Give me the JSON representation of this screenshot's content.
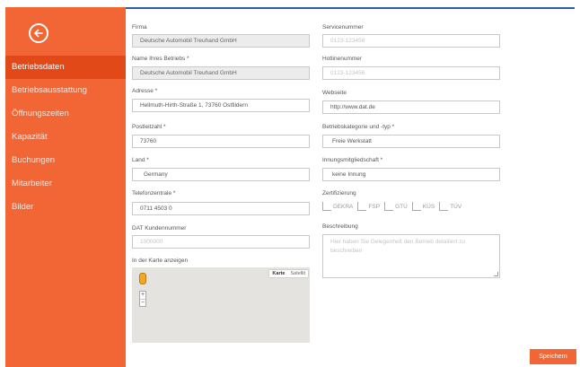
{
  "sidebar": {
    "items": [
      {
        "label": "Betriebsdaten"
      },
      {
        "label": "Betriebsausstattung"
      },
      {
        "label": "Öffnungszeiten"
      },
      {
        "label": "Kapazität"
      },
      {
        "label": "Buchungen"
      },
      {
        "label": "Mitarbeiter"
      },
      {
        "label": "Bilder"
      }
    ],
    "accent_color": "#f26534",
    "active_color": "#e14a18"
  },
  "form": {
    "firma": {
      "label": "Firma",
      "value": "Deutsche Automobil Treuhand GmbH"
    },
    "name_betrieb": {
      "label": "Name Ihres Betriebs *",
      "value": "Deutsche Automobil Treuhand GmbH"
    },
    "adresse": {
      "label": "Adresse *",
      "value": "Hellmuth-Hirth-Straße 1, 73760 Ostfildern"
    },
    "postleitzahl": {
      "label": "Postleitzahl *",
      "value": "73760"
    },
    "land": {
      "label": "Land *",
      "value": "Germany"
    },
    "telefonzentrale": {
      "label": "Telefonzentrale *",
      "value": "0711 4503 0"
    },
    "dat_kundennummer": {
      "label": "DAT Kundennummer",
      "value": "1000000"
    },
    "karte": {
      "label": "In der Karte anzeigen",
      "map_type": "Karte",
      "satellite": "Satellit",
      "zoom_in": "+",
      "zoom_out": "−"
    },
    "servicenummer": {
      "label": "Servicenummer",
      "placeholder": "0123-123456"
    },
    "hotlinenummer": {
      "label": "Hotlinenummer",
      "placeholder": "0123-123456"
    },
    "webseite": {
      "label": "Webseite",
      "value": "http://www.dat.de"
    },
    "betriebskategorie": {
      "label": "Betriebskategorie und -typ *",
      "value": "Freie Werkstatt"
    },
    "innung": {
      "label": "Innungsmitgliedschaft *",
      "value": "keine Innung"
    },
    "zertifizierung": {
      "label": "Zertifizierung",
      "options": [
        "DEKRA",
        "FSP",
        "GTÜ",
        "KÜS",
        "TÜV"
      ]
    },
    "beschreibung": {
      "label": "Beschreibung",
      "placeholder": "Hier haben Sie Gelegenheit den Betrieb detailiert zu beschreiben"
    }
  },
  "actions": {
    "save_label": "Speichern"
  }
}
